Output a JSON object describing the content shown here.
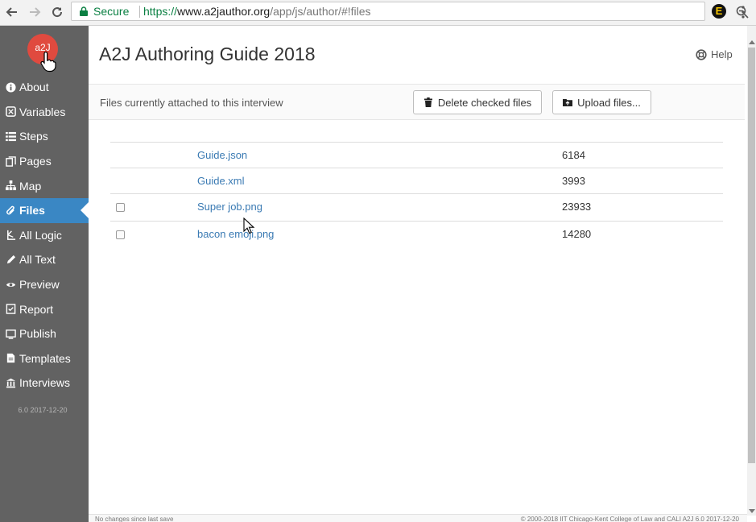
{
  "browser": {
    "secure_label": "Secure",
    "url_scheme": "https://",
    "url_host": "www.a2jauthor.org",
    "url_path": "/app/js/author/#!files",
    "extension_label": "E"
  },
  "sidebar": {
    "logo_text": "a2J",
    "items": [
      {
        "label": "About",
        "icon": "info-icon"
      },
      {
        "label": "Variables",
        "icon": "variables-icon"
      },
      {
        "label": "Steps",
        "icon": "list-icon"
      },
      {
        "label": "Pages",
        "icon": "pages-icon"
      },
      {
        "label": "Map",
        "icon": "sitemap-icon"
      },
      {
        "label": "Files",
        "icon": "paperclip-icon",
        "active": true
      },
      {
        "label": "All Logic",
        "icon": "logic-icon"
      },
      {
        "label": "All Text",
        "icon": "pencil-icon"
      },
      {
        "label": "Preview",
        "icon": "eye-icon"
      },
      {
        "label": "Report",
        "icon": "report-icon"
      },
      {
        "label": "Publish",
        "icon": "publish-icon"
      },
      {
        "label": "Templates",
        "icon": "template-icon"
      },
      {
        "label": "Interviews",
        "icon": "bank-icon"
      }
    ],
    "version": "6.0 2017-12-20"
  },
  "main": {
    "title": "A2J Authoring Guide 2018",
    "help_label": "Help",
    "toolbar": {
      "description": "Files currently attached to this interview",
      "delete_label": "Delete checked files",
      "upload_label": "Upload files..."
    },
    "files": [
      {
        "name": "Guide.json",
        "size": "6184",
        "checkbox": false
      },
      {
        "name": "Guide.xml",
        "size": "3993",
        "checkbox": false
      },
      {
        "name": "Super job.png",
        "size": "23933",
        "checkbox": true
      },
      {
        "name": "bacon emoji.png",
        "size": "14280",
        "checkbox": true
      }
    ]
  },
  "footer": {
    "status": "No changes since last save",
    "copyright": "© 2000-2018 IIT Chicago-Kent College of Law and CALI A2J 6.0 2017-12-20"
  },
  "colors": {
    "sidebar_bg": "#626262",
    "active_bg": "#3a87c4",
    "logo_bg": "#e04a3f",
    "link": "#3a7ab3",
    "secure": "#0b8043"
  }
}
